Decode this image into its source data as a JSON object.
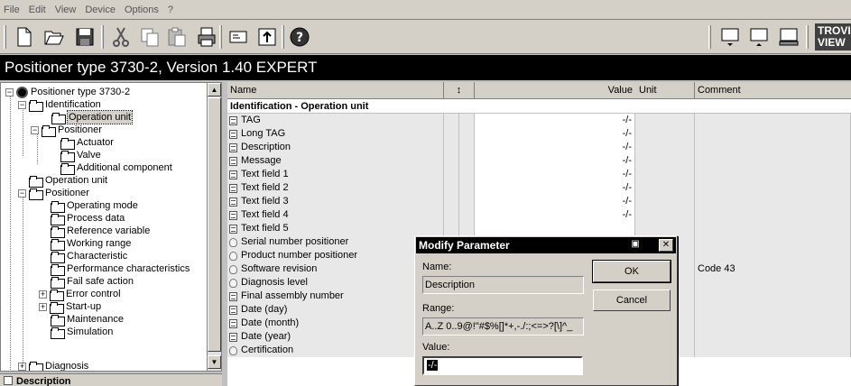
{
  "menu": [
    {
      "label": "File",
      "u": "F"
    },
    {
      "label": "Edit",
      "u": "E"
    },
    {
      "label": "View",
      "u": "V"
    },
    {
      "label": "Device",
      "u": "D"
    },
    {
      "label": "Options",
      "u": "O"
    },
    {
      "label": "?",
      "u": "?"
    }
  ],
  "toolbar": {
    "icons": [
      "new-icon",
      "open-icon",
      "save-icon",
      "cut-icon",
      "copy-icon",
      "paste-icon",
      "print-icon",
      "device-icon",
      "upload-icon",
      "help-icon",
      "monitor-down-icon",
      "monitor-up-icon",
      "monitor-icon"
    ],
    "brand": "TROVIS VIEW"
  },
  "title": "Positioner type 3730-2, Version 1.40 EXPERT",
  "tree": {
    "root": "Positioner type 3730-2",
    "identification": "Identification",
    "operation_unit_sel": "Operation unit",
    "positioner_sub": "Positioner",
    "actuator": "Actuator",
    "valve": "Valve",
    "additional": "Additional component",
    "operation_unit": "Operation unit",
    "positioner": "Positioner",
    "operating_mode": "Operating mode",
    "process_data": "Process data",
    "reference_variable": "Reference variable",
    "working_range": "Working range",
    "characteristic": "Characteristic",
    "performance": "Performance characteristics",
    "fail_safe": "Fail safe action",
    "error_control": "Error control",
    "startup": "Start-up",
    "maintenance": "Maintenance",
    "simulation": "Simulation",
    "diagnosis": "Diagnosis"
  },
  "description_panel": "Description",
  "grid": {
    "headers": {
      "name": "Name",
      "value": "Value",
      "unit": "Unit",
      "comment": "Comment"
    },
    "section": "Identification - Operation unit",
    "rows": [
      {
        "name": "TAG",
        "value": "-/-",
        "comment": "",
        "type": "param"
      },
      {
        "name": "Long TAG",
        "value": "-/-",
        "comment": "",
        "type": "param"
      },
      {
        "name": "Description",
        "value": "-/-",
        "comment": "",
        "type": "param"
      },
      {
        "name": "Message",
        "value": "-/-",
        "comment": "",
        "type": "param"
      },
      {
        "name": "Text field 1",
        "value": "-/-",
        "comment": "",
        "type": "param"
      },
      {
        "name": "Text field 2",
        "value": "-/-",
        "comment": "",
        "type": "param"
      },
      {
        "name": "Text field 3",
        "value": "-/-",
        "comment": "",
        "type": "param"
      },
      {
        "name": "Text field 4",
        "value": "-/-",
        "comment": "",
        "type": "param"
      },
      {
        "name": "Text field 5",
        "value": "",
        "comment": "",
        "type": "param"
      },
      {
        "name": "Serial number positioner",
        "value": "",
        "comment": "",
        "type": "read"
      },
      {
        "name": "Product number positioner",
        "value": "",
        "comment": "",
        "type": "read"
      },
      {
        "name": "Software revision",
        "value": "",
        "comment": "Code 43",
        "type": "read"
      },
      {
        "name": "Diagnosis level",
        "value": "",
        "comment": "",
        "type": "read"
      },
      {
        "name": "Final assembly number",
        "value": "",
        "comment": "",
        "type": "param"
      },
      {
        "name": "Date (day)",
        "value": "",
        "comment": "",
        "type": "param"
      },
      {
        "name": "Date (month)",
        "value": "",
        "comment": "",
        "type": "param"
      },
      {
        "name": "Date (year)",
        "value": "",
        "comment": "",
        "type": "param"
      },
      {
        "name": "Certification",
        "value": "",
        "comment": "",
        "type": "read"
      }
    ]
  },
  "dialog": {
    "title": "Modify Parameter",
    "name_label": "Name:",
    "name_value": "Description",
    "range_label": "Range:",
    "range_value": "A..Z 0..9@!\"#$%[]*+,-./:;<=>?[\\]^_",
    "value_label": "Value:",
    "value": "-/-",
    "ok": "OK",
    "cancel": "Cancel"
  }
}
